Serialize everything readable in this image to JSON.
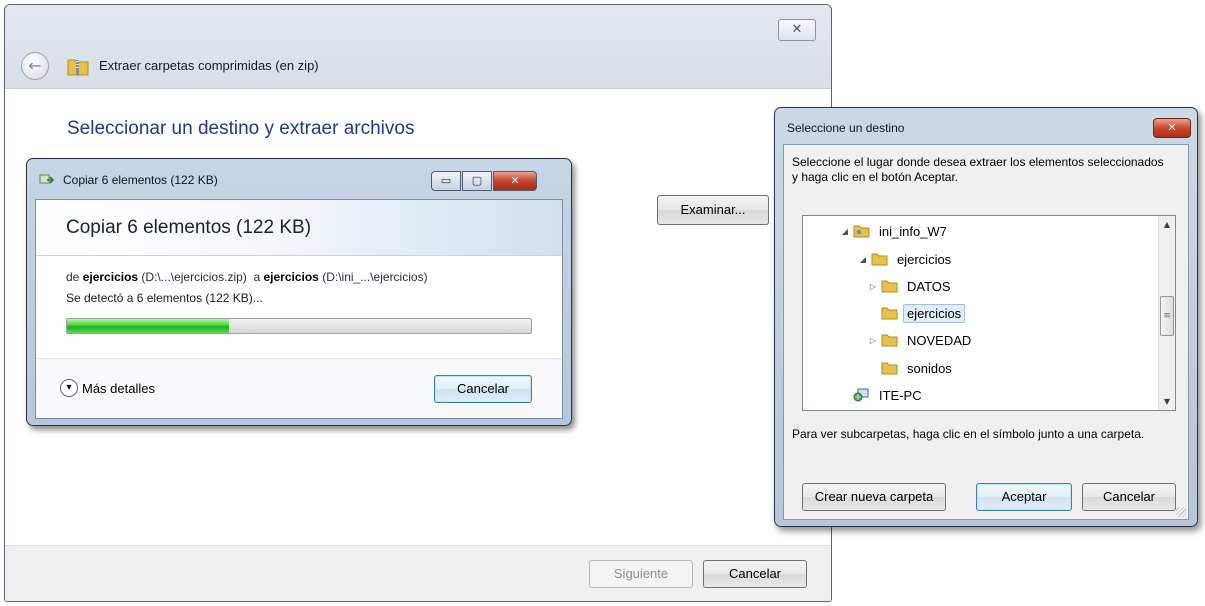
{
  "wizard": {
    "title": "Extraer carpetas comprimidas (en zip)",
    "close_glyph": "✕",
    "back_glyph": "←",
    "heading": "Seleccionar un destino y extraer archivos",
    "browse_button": "Examinar...",
    "next_button": "Siguiente",
    "cancel_button": "Cancelar"
  },
  "copy_dialog": {
    "window_title": "Copiar 6 elementos (122 KB)",
    "header_title": "Copiar 6 elementos (122 KB)",
    "from_prefix": "de",
    "source_name": "ejercicios",
    "source_path": "(D:\\...\\ejercicios.zip)",
    "to_prefix": "a",
    "dest_name": "ejercicios",
    "dest_path": "(D:\\ini_...\\ejercicios)",
    "status": "Se detectó a 6 elementos (122 KB)...",
    "progress_fraction": 0.35,
    "more_details": "Más detalles",
    "cancel_button": "Cancelar",
    "minimize_glyph": "▭",
    "maximize_glyph": "▢",
    "close_glyph": "✕"
  },
  "browse_dialog": {
    "title": "Seleccione un destino",
    "close_glyph": "✕",
    "instructions": "Seleccione el lugar donde desea extraer los elementos seleccionados y haga clic en el botón Aceptar.",
    "tree": [
      {
        "label": "ini_info_W7",
        "expander": "◢",
        "icon": "user-folder-icon",
        "selected": false
      },
      {
        "label": "ejercicios",
        "expander": "◢",
        "icon": "folder-icon",
        "selected": false
      },
      {
        "label": "DATOS",
        "expander": "▷",
        "icon": "folder-icon",
        "selected": false
      },
      {
        "label": "ejercicios",
        "expander": "",
        "icon": "folder-icon",
        "selected": true
      },
      {
        "label": "NOVEDAD",
        "expander": "▷",
        "icon": "folder-icon",
        "selected": false
      },
      {
        "label": "sonidos",
        "expander": "",
        "icon": "folder-icon",
        "selected": false
      },
      {
        "label": "ITE-PC",
        "expander": "",
        "icon": "network-computer-icon",
        "selected": false
      }
    ],
    "hint": "Para ver subcarpetas, haga clic en el símbolo junto a una carpeta.",
    "new_folder_button": "Crear nueva carpeta",
    "accept_button": "Aceptar",
    "cancel_button": "Cancelar"
  },
  "colors": {
    "heading_blue": "#1e3a8a",
    "progress_green": "#20b11c",
    "close_red": "#c4452b",
    "folder_yellow": "#e8c14a"
  }
}
